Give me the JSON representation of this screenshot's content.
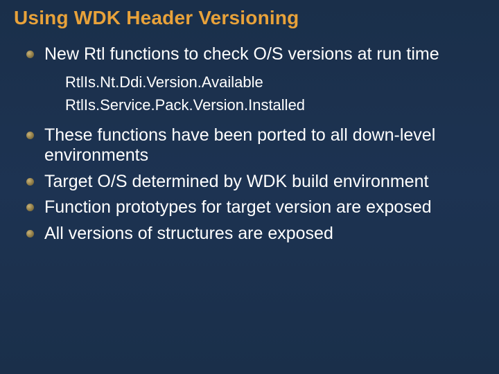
{
  "title": "Using WDK Header Versioning",
  "bullets": [
    {
      "text": "New Rtl functions to check O/S versions at run time",
      "sub": [
        "RtlIs.Nt.Ddi.Version.Available",
        "RtlIs.Service.Pack.Version.Installed"
      ]
    },
    {
      "text": "These functions have been ported to all down-level environments"
    },
    {
      "text": "Target O/S determined by WDK build environment"
    },
    {
      "text": "Function prototypes for target version are exposed"
    },
    {
      "text": "All versions of structures are exposed"
    }
  ]
}
